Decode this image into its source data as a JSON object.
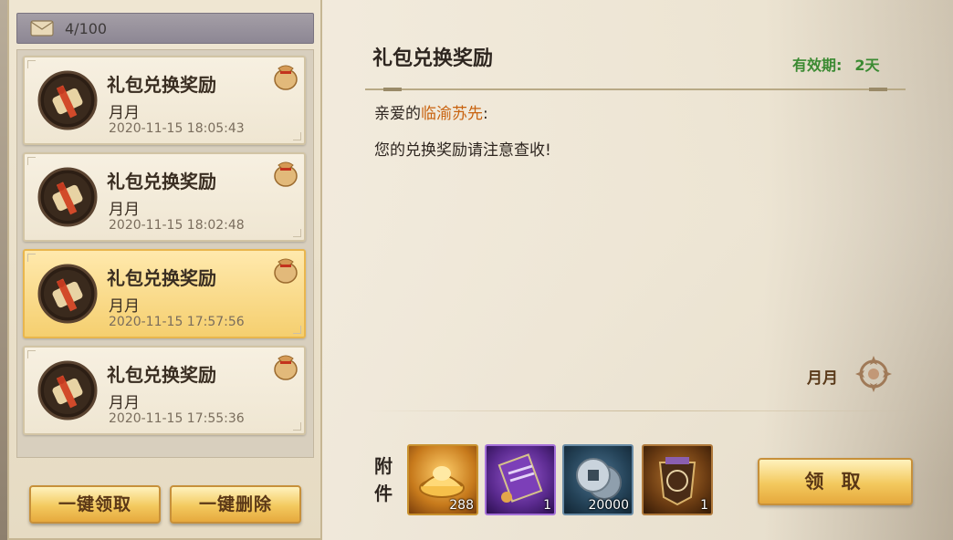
{
  "mailbox": {
    "count_text": "4/100"
  },
  "mail_list": [
    {
      "title": "礼包兑换奖励",
      "sender": "月月",
      "date": "2020-11-15 18:05:43",
      "selected": false
    },
    {
      "title": "礼包兑换奖励",
      "sender": "月月",
      "date": "2020-11-15 18:02:48",
      "selected": false
    },
    {
      "title": "礼包兑换奖励",
      "sender": "月月",
      "date": "2020-11-15 17:57:56",
      "selected": true
    },
    {
      "title": "礼包兑换奖励",
      "sender": "月月",
      "date": "2020-11-15 17:55:36",
      "selected": false
    }
  ],
  "buttons": {
    "claim_all": "一键领取",
    "delete_all": "一键删除",
    "claim": "领 取"
  },
  "detail": {
    "title": "礼包兑换奖励",
    "validity_label": "有效期:",
    "validity_value": "2天",
    "greeting_prefix": "亲爱的",
    "recipient_name": "临渝苏先",
    "greeting_suffix": ":",
    "body": "您的兑换奖励请注意查收!",
    "signature": "月月",
    "attachment_label": "附件"
  },
  "attachments": [
    {
      "icon": "gold-ingot-icon",
      "count": "288",
      "rarity_color": "#c77a1c"
    },
    {
      "icon": "purple-scroll-icon",
      "count": "1",
      "rarity_color": "#5a2a8e"
    },
    {
      "icon": "silver-coin-icon",
      "count": "20000",
      "rarity_color": "#244257"
    },
    {
      "icon": "sage-token-icon",
      "count": "1",
      "rarity_color": "#6a3b12"
    }
  ],
  "colors": {
    "validity_green": "#3b8a32",
    "recipient_orange": "#c8620f",
    "selected_item": "#f5cf6f"
  }
}
